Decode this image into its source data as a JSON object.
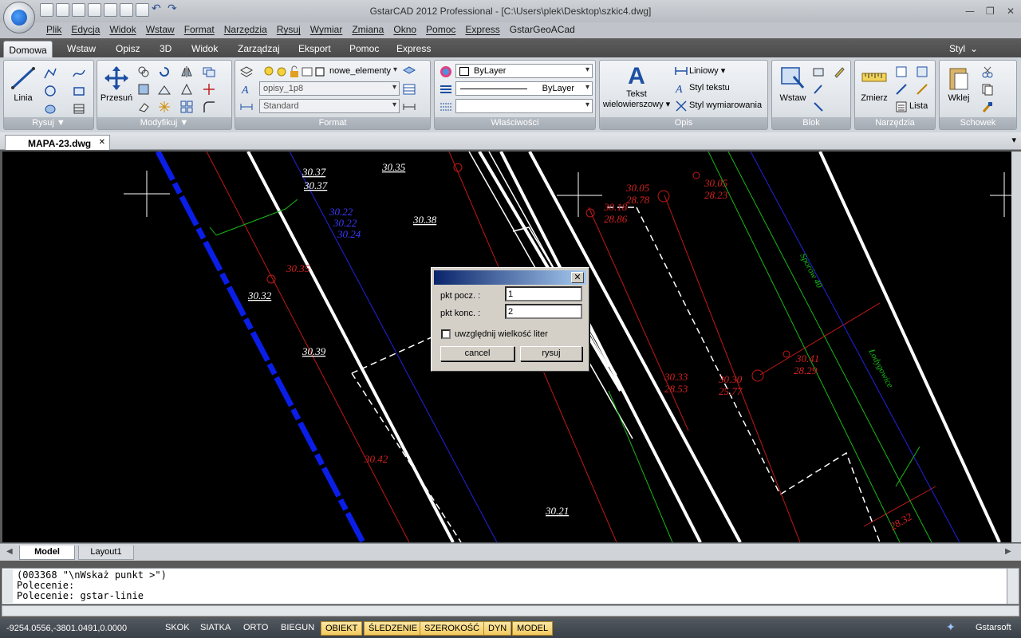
{
  "titlebar": {
    "title": "GstarCAD 2012 Professional - [C:\\Users\\plek\\Desktop\\szkic4.dwg]",
    "min": "—",
    "restore": "❐",
    "close": "✕"
  },
  "menubar": {
    "items": [
      "Plik",
      "Edycja",
      "Widok",
      "Wstaw",
      "Format",
      "Narzędzia",
      "Rysuj",
      "Wymiar",
      "Zmiana",
      "Okno",
      "Pomoc",
      "Express",
      "GstarGeoACad"
    ]
  },
  "ribbon_tabs": {
    "active": "Domowa",
    "items": [
      "Wstaw",
      "Opisz",
      "3D",
      "Widok",
      "Zarządzaj",
      "Eksport",
      "Pomoc",
      "Express"
    ],
    "style_label": "Styl",
    "style_arrow": "⌄"
  },
  "panels": {
    "rysuj": {
      "title": "Rysuj ▼",
      "linia": "Linia"
    },
    "modyfikuj": {
      "title": "Modyfikuj ▼",
      "przesun": "Przesuń"
    },
    "format": {
      "title": "Format",
      "layer": "nowe_elementy",
      "textstyle": "opisy_1p8",
      "dimstyle": "Standard"
    },
    "wlasciwosci": {
      "title": "Właściwości",
      "color": "ByLayer",
      "linetype": "ByLayer",
      "lineweight": ""
    },
    "opis": {
      "title": "Opis",
      "tekst_line1": "Tekst",
      "tekst_line2": "wielowierszowy ▾",
      "liniowy": "Liniowy ▾",
      "styl_tekstu": "Styl tekstu",
      "styl_wymiarowania": "Styl wymiarowania"
    },
    "blok": {
      "title": "Blok",
      "wstaw": "Wstaw"
    },
    "narzedzia": {
      "title": "Narzędzia",
      "zmierz": "Zmierz",
      "lista": "Lista"
    },
    "schowek": {
      "title": "Schowek",
      "wklej": "Wklej"
    }
  },
  "document": {
    "tab_label": "MAPA-23.dwg",
    "close": "✕"
  },
  "drawing": {
    "labels_white": [
      "30.35",
      "30.37",
      "30.37",
      "30.38",
      "30.32",
      "30.39",
      "30.21"
    ],
    "labels_blue": [
      "30.22",
      "30.22",
      "30.24"
    ],
    "labels_red": [
      "30.05",
      "28.23",
      "30.05",
      "28.78",
      "30.18",
      "28.86",
      "30.35",
      "30.42",
      "30.41",
      "28.29",
      "30.33",
      "28.53",
      "30.30",
      "25.77",
      "28.32"
    ],
    "labels_green": [
      "Łodygowice",
      "Sporów 40"
    ]
  },
  "layout_tabs": {
    "model": "Model",
    "layout1": "Layout1"
  },
  "command": {
    "lines": [
      "(003368 \"\\nWskaż punkt >\")",
      "Polecenie:",
      "Polecenie: gstar-linie"
    ]
  },
  "statusbar": {
    "coords": "-9254.0556,-3801.0491,0.0000",
    "buttons": [
      "SKOK",
      "SIATKA",
      "ORTO",
      "BIEGUN"
    ],
    "buttons_on": [
      "OBIEKT",
      "ŚLEDZENIE",
      "SZEROKOŚĆ",
      "DYN",
      "MODEL"
    ],
    "brand": "Gstarsoft"
  },
  "dialog": {
    "close": "✕",
    "start_label": "pkt pocz. :",
    "start_value": "1",
    "end_label": "pkt konc. :",
    "end_value": "2",
    "case_label": "uwzględnij wielkość liter",
    "case_checked": false,
    "cancel": "cancel",
    "draw": "rysuj"
  }
}
